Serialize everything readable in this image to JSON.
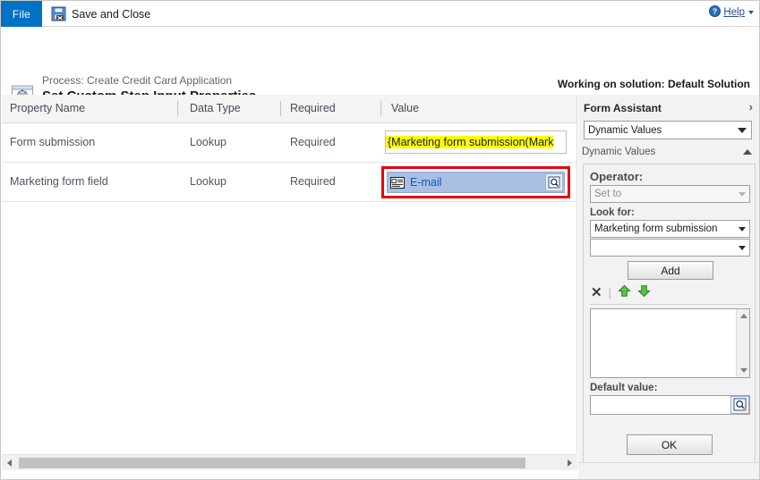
{
  "ribbon": {
    "file_tab_label": "File",
    "save_and_close_label": "Save and Close",
    "save_icon": "save-close-floppy-icon",
    "help_label": "Help",
    "help_icon": "help-circle-icon"
  },
  "title_block": {
    "process_line": "Process: Create Credit Card Application",
    "page_title": "Set Custom Step Input Properties",
    "solution_status": "Working on solution: Default Solution",
    "gear_icon": "gear-window-icon"
  },
  "grid": {
    "columns": [
      "Property Name",
      "Data Type",
      "Required",
      "Value"
    ],
    "rows": [
      {
        "property_name": "Form submission",
        "data_type": "Lookup",
        "required": "Required",
        "value_text": "{Marketing form submission(Mark",
        "value_kind": "highlighted-text"
      },
      {
        "property_name": "Marketing form field",
        "data_type": "Lookup",
        "required": "Required",
        "value_text": "E-mail",
        "value_kind": "lookup-selected",
        "lookup_entity_icon": "record-card-icon",
        "lookup_button_icon": "lookup-magnifier-icon",
        "focus_outline_color": "#e8000d",
        "selection_color": "#a8c0e4",
        "value_link_color": "#1357b8"
      }
    ],
    "highlight_color": "#ffff00",
    "hscroll": {
      "left_arrow_icon": "scroll-left-arrow-icon",
      "right_arrow_icon": "scroll-right-arrow-icon"
    }
  },
  "form_assistant": {
    "header_title": "Form Assistant",
    "expand_icon": "chevron-right-icon",
    "type_select_value": "Dynamic Values",
    "section_label": "Dynamic Values",
    "collapse_icon": "chevron-up-icon",
    "operator_label": "Operator:",
    "operator_value": "Set to",
    "look_for_label": "Look for:",
    "look_for_value": "Marketing form submission",
    "look_for_field_value": "",
    "add_button_label": "Add",
    "delete_icon": "x-delete-icon",
    "move_up_icon": "green-arrow-up-icon",
    "move_down_icon": "green-arrow-down-icon",
    "list_items": [],
    "list_scroll_up_icon": "scroll-up-arrow-icon",
    "list_scroll_down_icon": "scroll-down-arrow-icon",
    "default_value_label": "Default value:",
    "default_value_text": "",
    "default_value_button_icon": "lookup-magnifier-icon",
    "ok_button_label": "OK"
  }
}
